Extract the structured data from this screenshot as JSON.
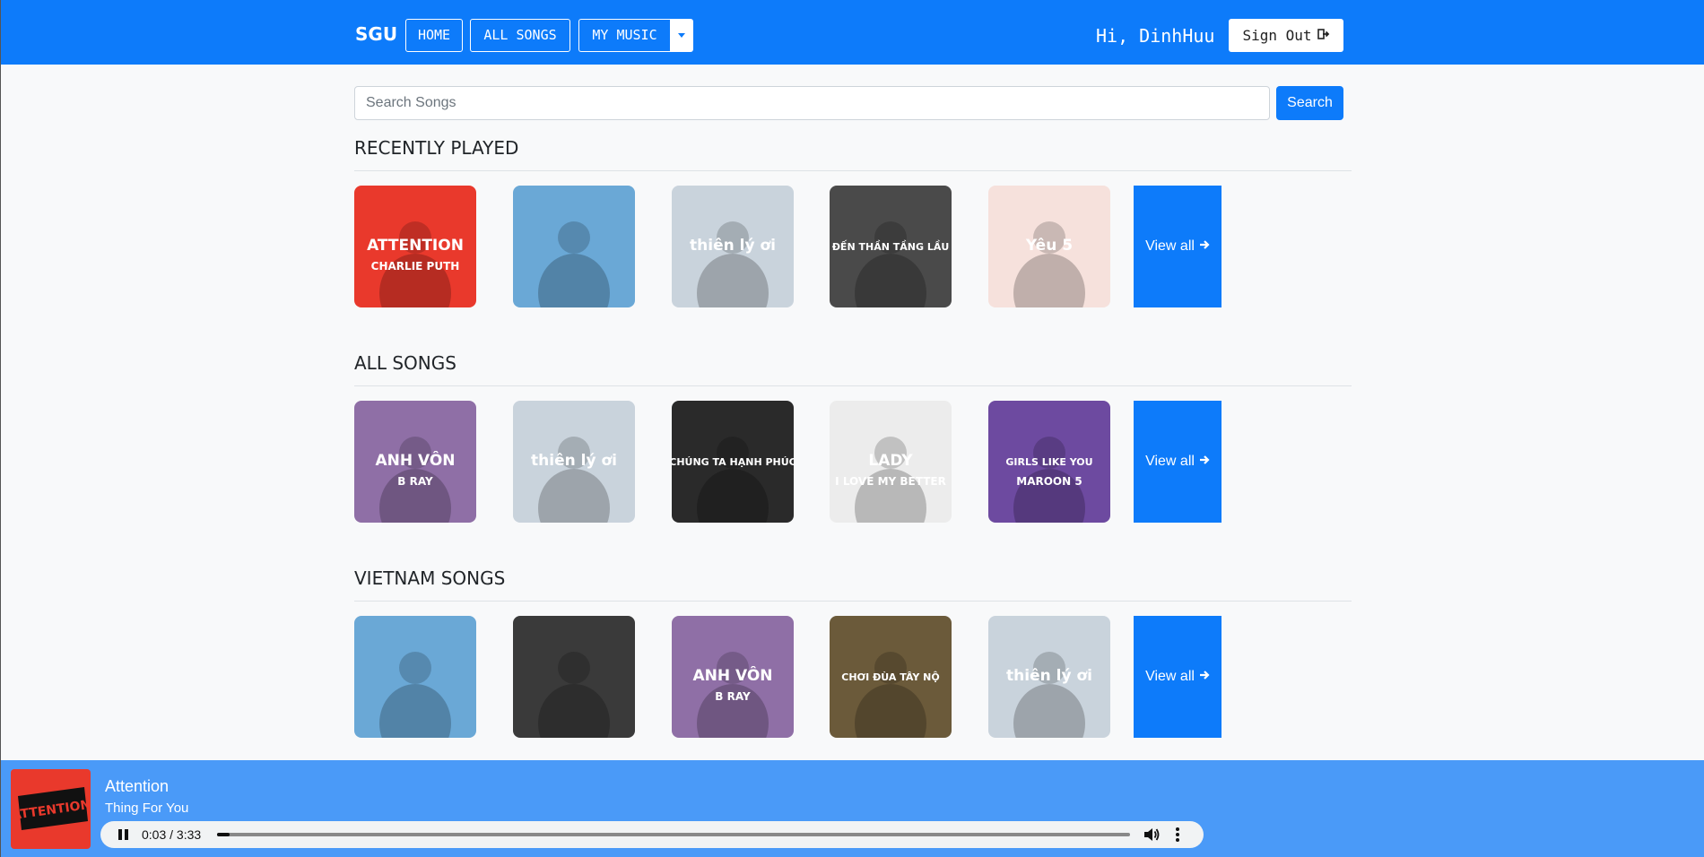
{
  "navbar": {
    "brand": "SGU",
    "home": "HOME",
    "all_songs": "ALL SONGS",
    "my_music": "MY MUSIC",
    "greeting": "Hi, DinhHuu",
    "sign_out": "Sign Out",
    "sign_out_icon": "sign-out-icon",
    "accent": "#0d7bfa"
  },
  "search": {
    "placeholder": "Search Songs",
    "button": "Search"
  },
  "sections": [
    {
      "title": "RECENTLY PLAYED",
      "view_all": "View all",
      "covers": [
        {
          "text": "ATTENTION",
          "sub": "CHARLIE PUTH",
          "bg": "#e9392c"
        },
        {
          "text": "",
          "sub": "",
          "bg": "#6aa8d6"
        },
        {
          "text": "thiên lý ơi",
          "sub": "",
          "bg": "#c9d3dc"
        },
        {
          "text": "ĐẾN THẦN TẦNG LẦU",
          "sub": "",
          "bg": "#4a4a4a"
        },
        {
          "text": "Yêu 5",
          "sub": "",
          "bg": "#f6e1dc"
        }
      ]
    },
    {
      "title": "ALL SONGS",
      "view_all": "View all",
      "covers": [
        {
          "text": "ANH VÔN",
          "sub": "B RAY",
          "bg": "#8f6fa6"
        },
        {
          "text": "thiên lý ơi",
          "sub": "",
          "bg": "#c9d3dc"
        },
        {
          "text": "CHÚNG TA HẠNH PHÚC",
          "sub": "",
          "bg": "#2a2a2a"
        },
        {
          "text": "LADY",
          "sub": "I LOVE MY BETTER",
          "bg": "#ececec"
        },
        {
          "text": "GIRLS LIKE YOU",
          "sub": "MAROON 5",
          "bg": "#6d4aa0"
        }
      ]
    },
    {
      "title": "VIETNAM SONGS",
      "view_all": "View all",
      "covers": [
        {
          "text": "",
          "sub": "",
          "bg": "#6aa8d6"
        },
        {
          "text": "",
          "sub": "",
          "bg": "#3a3a3a"
        },
        {
          "text": "ANH VÔN",
          "sub": "B RAY",
          "bg": "#8f6fa6"
        },
        {
          "text": "CHƠI ĐÙA TÂY NỘ",
          "sub": "",
          "bg": "#6b5a3a"
        },
        {
          "text": "thiên lý ơi",
          "sub": "",
          "bg": "#c9d3dc"
        }
      ]
    }
  ],
  "player": {
    "title": "Attention",
    "artist": "Thing For You",
    "time": "0:03 / 3:33",
    "progress": 0.014,
    "pause_icon": "pause-icon",
    "volume_icon": "volume-icon",
    "more_icon": "more-options-icon"
  }
}
